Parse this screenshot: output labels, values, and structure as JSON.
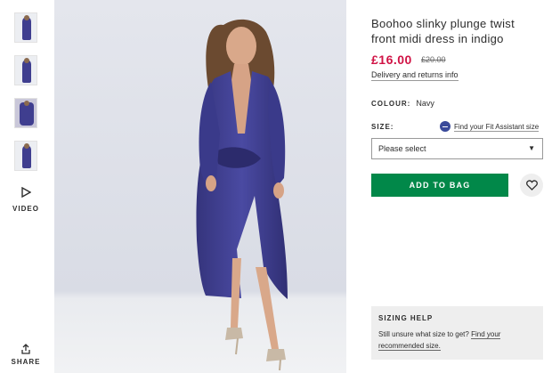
{
  "product": {
    "title": "Boohoo slinky plunge twist front midi dress in indigo",
    "price_now": "£16.00",
    "price_was": "£20.00",
    "delivery_link": "Delivery and returns info",
    "colour_label": "COLOUR:",
    "colour_value": "Navy"
  },
  "size": {
    "label": "SIZE:",
    "fit_assistant": "Find your Fit Assistant size",
    "select_placeholder": "Please select"
  },
  "actions": {
    "add_to_bag": "ADD TO BAG"
  },
  "gallery": {
    "video_label": "VIDEO",
    "share_label": "SHARE"
  },
  "sizing_help": {
    "heading": "SIZING HELP",
    "text": "Still unsure what size to get?",
    "link": "Find your recommended size."
  },
  "colors": {
    "price": "#d01345",
    "add_button": "#018849",
    "dress": "#3f3e8f"
  }
}
